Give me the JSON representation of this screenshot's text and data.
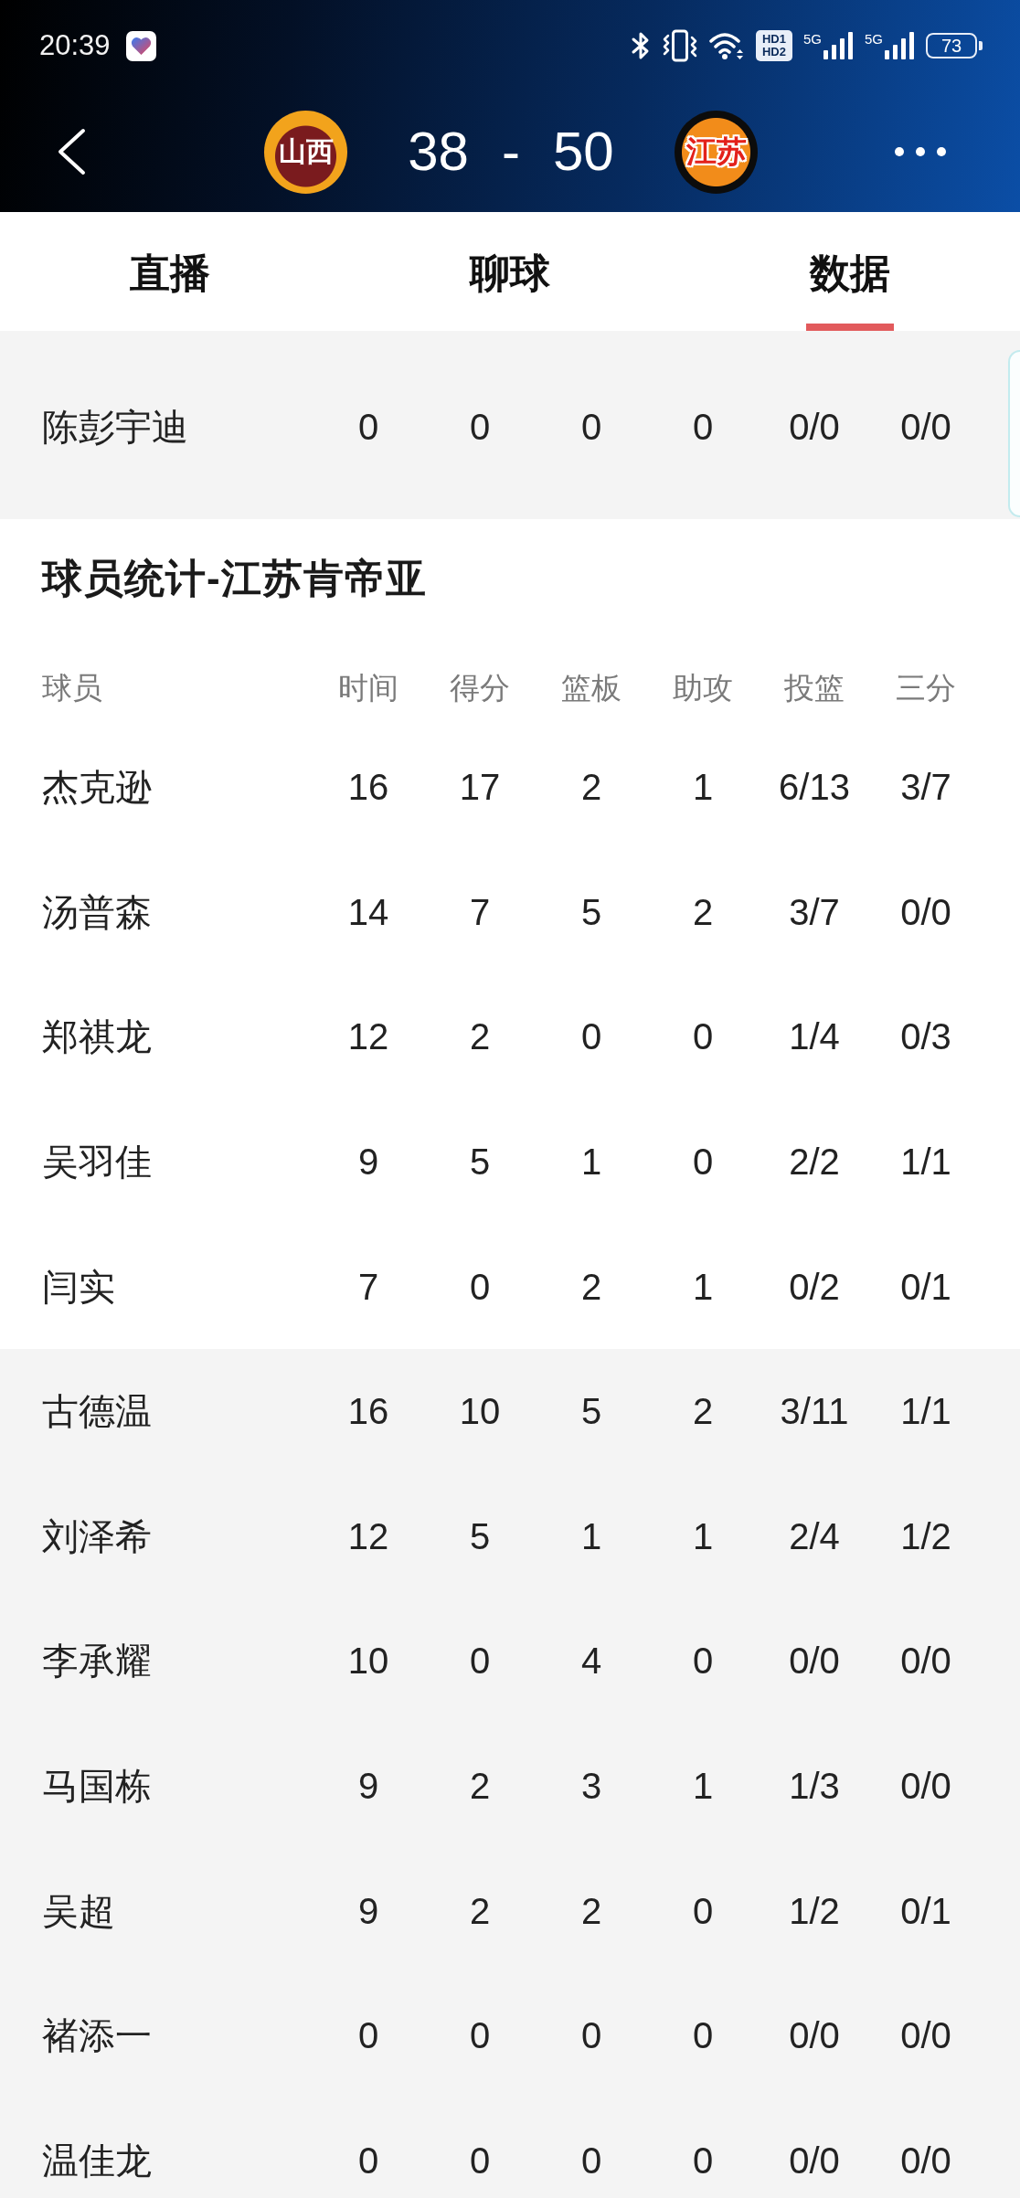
{
  "status_bar": {
    "time": "20:39",
    "hd_labels": [
      "HD1",
      "HD2"
    ],
    "networks": [
      "5G",
      "5G"
    ],
    "battery": "73"
  },
  "match_header": {
    "home_logo_text": "山西",
    "home_score": "38",
    "separator": "-",
    "away_score": "50",
    "away_logo_text": "江苏"
  },
  "tabs": [
    {
      "label": "直播",
      "selected": false
    },
    {
      "label": "聊球",
      "selected": false
    },
    {
      "label": "数据",
      "selected": true
    }
  ],
  "previous_rows": [
    [
      "陈彭宇迪",
      "0",
      "0",
      "0",
      "0",
      "0/0",
      "0/0"
    ]
  ],
  "player_stats": {
    "title": "球员统计-江苏肯帝亚",
    "columns": [
      "球员",
      "时间",
      "得分",
      "篮板",
      "助攻",
      "投篮",
      "三分"
    ],
    "starters": [
      [
        "杰克逊",
        "16",
        "17",
        "2",
        "1",
        "6/13",
        "3/7"
      ],
      [
        "汤普森",
        "14",
        "7",
        "5",
        "2",
        "3/7",
        "0/0"
      ],
      [
        "郑祺龙",
        "12",
        "2",
        "0",
        "0",
        "1/4",
        "0/3"
      ],
      [
        "吴羽佳",
        "9",
        "5",
        "1",
        "0",
        "2/2",
        "1/1"
      ],
      [
        "闫实",
        "7",
        "0",
        "2",
        "1",
        "0/2",
        "0/1"
      ]
    ],
    "bench": [
      [
        "古德温",
        "16",
        "10",
        "5",
        "2",
        "3/11",
        "1/1"
      ],
      [
        "刘泽希",
        "12",
        "5",
        "1",
        "1",
        "2/4",
        "1/2"
      ],
      [
        "李承耀",
        "10",
        "0",
        "4",
        "0",
        "0/0",
        "0/0"
      ],
      [
        "马国栋",
        "9",
        "2",
        "3",
        "1",
        "1/3",
        "0/0"
      ],
      [
        "吴超",
        "9",
        "2",
        "2",
        "0",
        "1/2",
        "0/1"
      ],
      [
        "褚添一",
        "0",
        "0",
        "0",
        "0",
        "0/0",
        "0/0"
      ],
      [
        "温佳龙",
        "0",
        "0",
        "0",
        "0",
        "0/0",
        "0/0"
      ]
    ]
  }
}
